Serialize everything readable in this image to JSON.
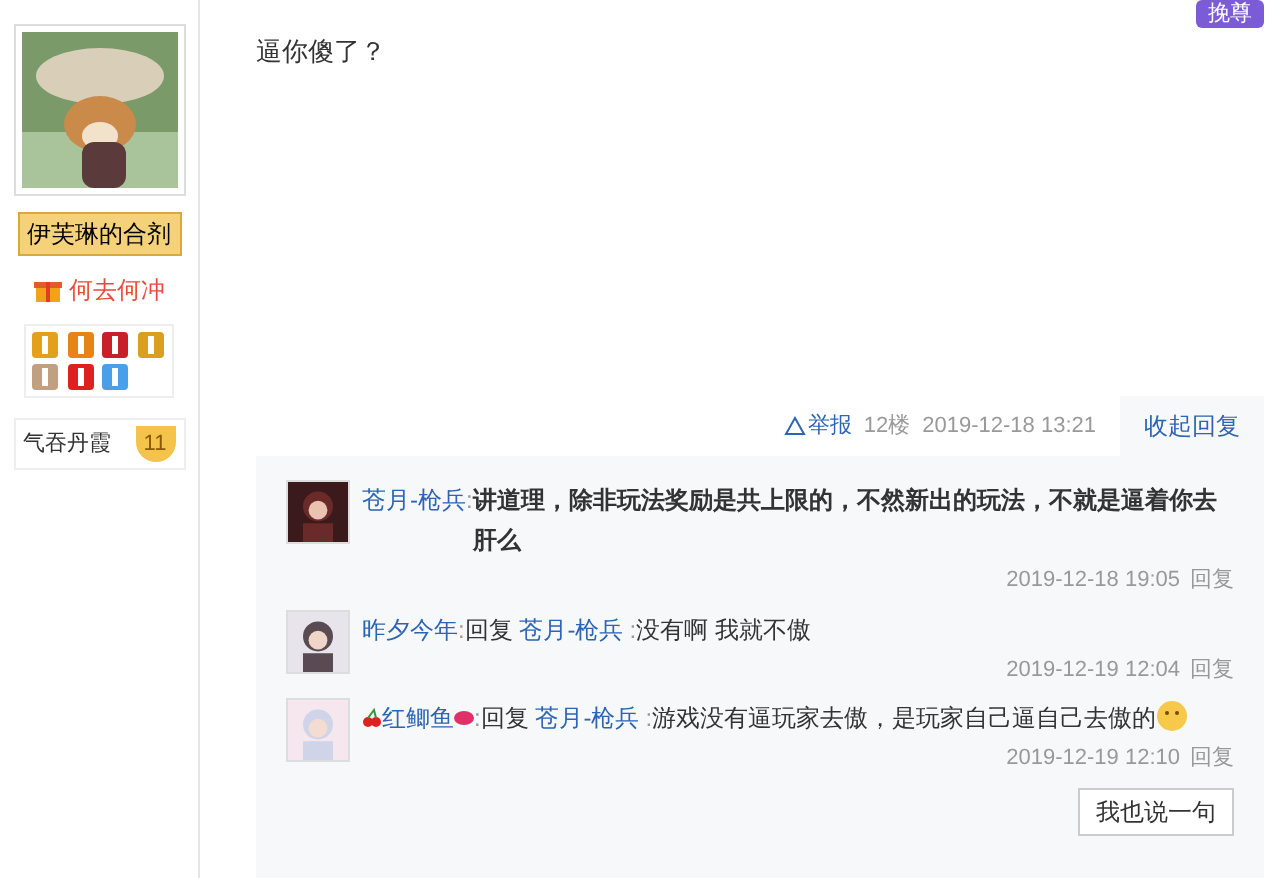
{
  "author": {
    "rank_badge": "伊芙琳的合剂",
    "title": "何去何冲",
    "level_name": "气吞丹霞",
    "level": "11"
  },
  "top_button": "挽尊",
  "post": {
    "text": "逼你傻了？",
    "report": "举报",
    "floor": "12楼",
    "time": "2019-12-18 13:21",
    "toggle": "收起回复"
  },
  "replies": [
    {
      "user": "苍月-枪兵",
      "sep": ":",
      "text": "讲道理，除非玩法奖励是共上限的，不然新出的玩法，不就是逼着你去肝么",
      "bold": true,
      "decorated_name": false,
      "emoticon": false,
      "time": "2019-12-18 19:05",
      "reply": "回复"
    },
    {
      "user": "昨夕今年",
      "sep": ":",
      "reply_word": "回复",
      "reply_to": "苍月-枪兵",
      "reply_sep": ":",
      "text": "没有啊 我就不傲",
      "bold": false,
      "decorated_name": false,
      "emoticon": false,
      "time": "2019-12-19 12:04",
      "reply": "回复"
    },
    {
      "user": "红鲫鱼",
      "sep": ":",
      "reply_word": "回复",
      "reply_to": "苍月-枪兵",
      "reply_sep": ":",
      "text": "游戏没有逼玩家去傲，是玩家自己逼自己去傲的",
      "bold": false,
      "decorated_name": true,
      "emoticon": true,
      "time": "2019-12-19 12:10",
      "reply": "回复"
    }
  ],
  "say_button": "我也说一句"
}
